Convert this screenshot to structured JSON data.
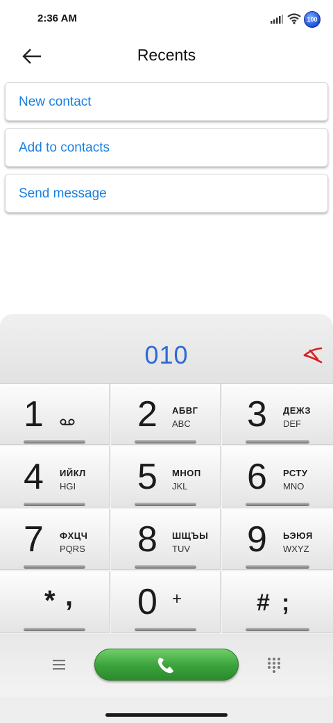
{
  "status_bar": {
    "time": "2:36 AM",
    "battery": "100"
  },
  "header": {
    "title": "Recents"
  },
  "actions": [
    {
      "label": "New contact"
    },
    {
      "label": "Add to contacts"
    },
    {
      "label": "Send message"
    }
  ],
  "dialer": {
    "number": "010",
    "keys": [
      {
        "digit": "1",
        "cyr": "",
        "lat": ""
      },
      {
        "digit": "2",
        "cyr": "АБВГ",
        "lat": "ABC"
      },
      {
        "digit": "3",
        "cyr": "ДЕЖЗ",
        "lat": "DEF"
      },
      {
        "digit": "4",
        "cyr": "ИЙКЛ",
        "lat": "HGI"
      },
      {
        "digit": "5",
        "cyr": "МНОП",
        "lat": "JKL"
      },
      {
        "digit": "6",
        "cyr": "РСТУ",
        "lat": "MNO"
      },
      {
        "digit": "7",
        "cyr": "ФХЦЧ",
        "lat": "PQRS"
      },
      {
        "digit": "8",
        "cyr": "ШЩЪЫ",
        "lat": "TUV"
      },
      {
        "digit": "9",
        "cyr": "ЬЭЮЯ",
        "lat": "WXYZ"
      },
      {
        "digit": "*,",
        "cyr": "",
        "lat": ""
      },
      {
        "digit": "0",
        "cyr": "+",
        "lat": ""
      },
      {
        "digit": "#;",
        "cyr": "",
        "lat": ""
      }
    ],
    "star_key": {
      "main": "*",
      "alt": ","
    },
    "zero_key": {
      "main": "0",
      "alt": "+"
    },
    "hash_key": {
      "main": "#",
      "alt": ";"
    }
  },
  "colors": {
    "accent": "#1a7fe0",
    "number": "#2d6ad3",
    "call": "#3aa23a",
    "delete": "#d32020"
  },
  "icons": [
    "signal-icon",
    "wifi-icon",
    "back-arrow-icon",
    "voicemail-icon",
    "delete-icon",
    "menu-icon",
    "phone-icon",
    "dialpad-icon"
  ]
}
